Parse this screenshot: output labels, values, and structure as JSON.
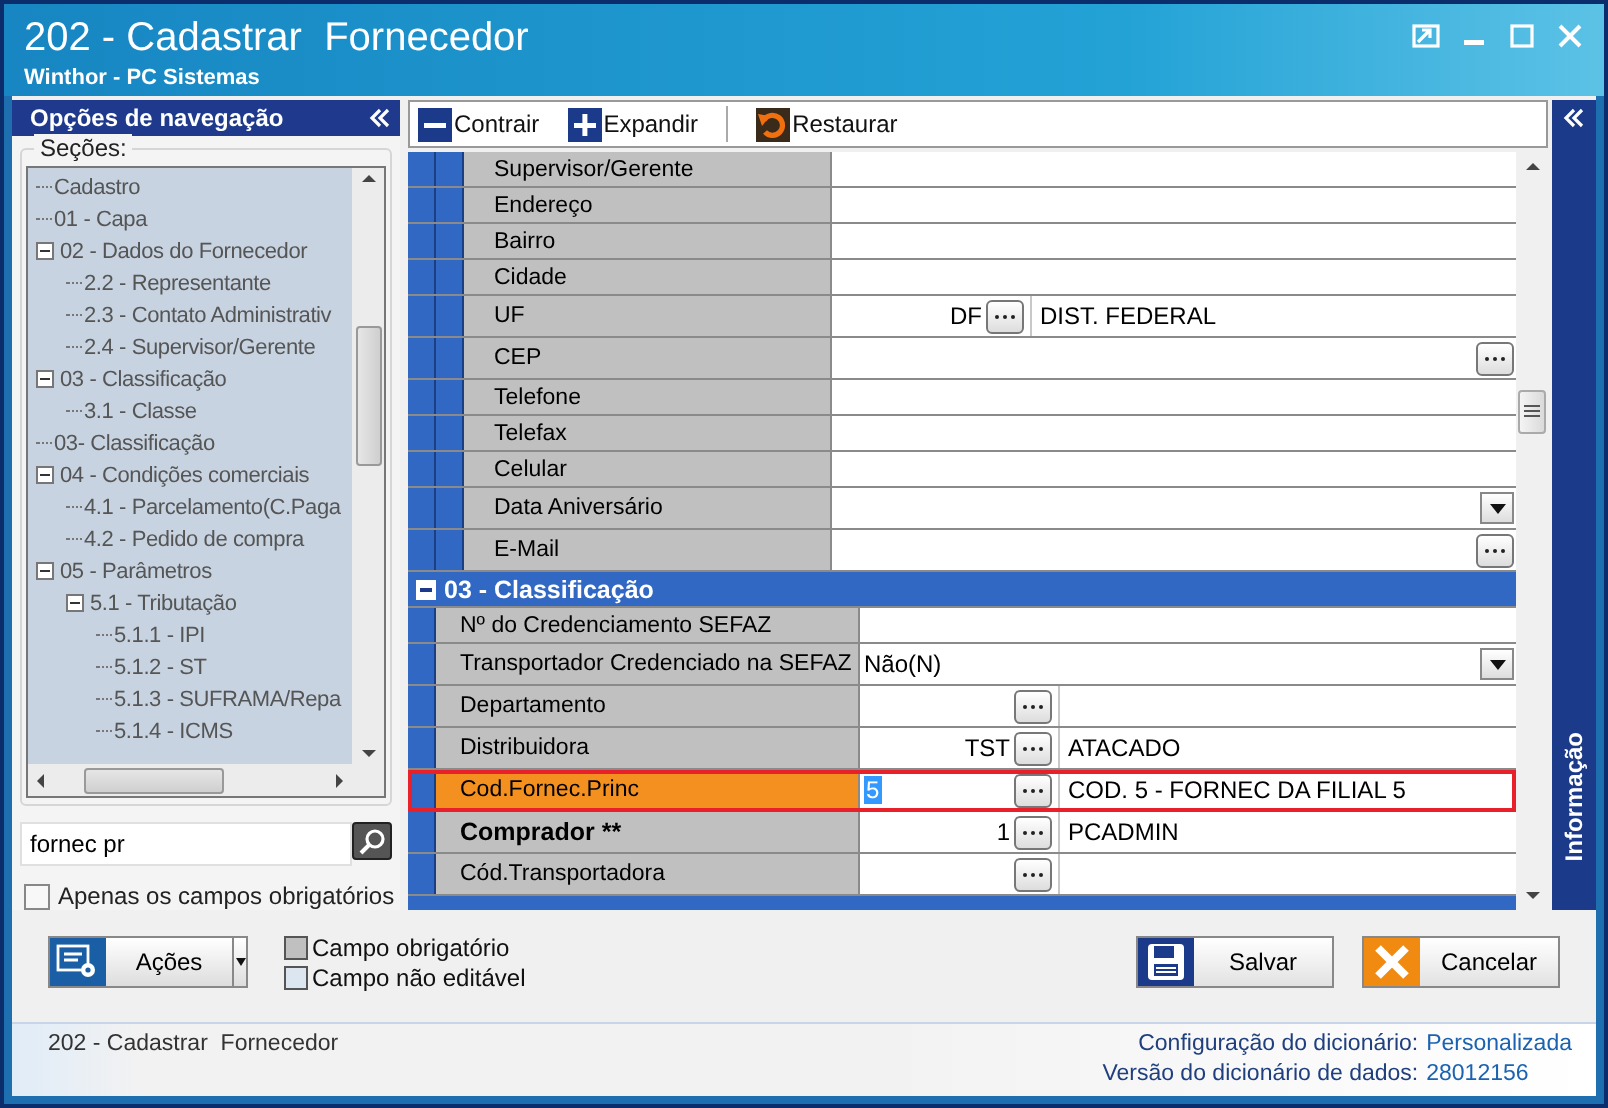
{
  "window": {
    "title": "202 - Cadastrar  Fornecedor",
    "subtitle": "Winthor - PC Sistemas"
  },
  "navigation": {
    "title": "Opções de navegação",
    "sections_label": "Seções:",
    "tree": [
      {
        "label": "Cadastro"
      },
      {
        "label": "01 - Capa"
      },
      {
        "label": "02 - Dados do Fornecedor",
        "expanded": true,
        "children": [
          {
            "label": "2.2 - Representante"
          },
          {
            "label": "2.3 - Contato Administrativ"
          },
          {
            "label": "2.4 - Supervisor/Gerente"
          }
        ]
      },
      {
        "label": "03 - Classificação",
        "expanded": true,
        "children": [
          {
            "label": "3.1 - Classe"
          }
        ]
      },
      {
        "label": "03- Classificação"
      },
      {
        "label": "04 - Condições comerciais",
        "expanded": true,
        "children": [
          {
            "label": "4.1 - Parcelamento(C.Paga"
          },
          {
            "label": "4.2 - Pedido de compra"
          }
        ]
      },
      {
        "label": "05 - Parâmetros",
        "expanded": true,
        "children": [
          {
            "label": "5.1 - Tributação",
            "expanded": true,
            "children": [
              {
                "label": "5.1.1 - IPI"
              },
              {
                "label": "5.1.2 - ST"
              },
              {
                "label": "5.1.3 - SUFRAMA/Repa"
              },
              {
                "label": "5.1.4 - ICMS"
              }
            ]
          }
        ]
      }
    ],
    "search": {
      "value": "fornec pr"
    },
    "required_only": {
      "label": "Apenas os campos obrigatórios",
      "checked": false
    }
  },
  "toolbar": [
    {
      "label": "Contrair",
      "kind": "collapse"
    },
    {
      "label": "Expandir",
      "kind": "expand"
    },
    {
      "label": "Restaurar",
      "kind": "restore"
    }
  ],
  "grid": {
    "sections": [
      {
        "subsections": [
          {
            "rows": [
              {
                "label": "Supervisor/Gerente",
                "kind": "text",
                "selected": false,
                "bold": false
              },
              {
                "label": "Endereço",
                "kind": "text",
                "selected": false,
                "bold": false
              },
              {
                "label": "Bairro",
                "kind": "text",
                "selected": false,
                "bold": false
              },
              {
                "label": "Cidade",
                "kind": "text",
                "selected": false,
                "bold": false
              },
              {
                "label": "UF",
                "kind": "lookup",
                "code": "DF",
                "description": "DIST. FEDERAL",
                "selected": false,
                "bold": false
              },
              {
                "label": "CEP",
                "kind": "ellipsis",
                "selected": false,
                "bold": false
              },
              {
                "label": "Telefone",
                "kind": "text",
                "selected": false,
                "bold": false
              },
              {
                "label": "Telefax",
                "kind": "text",
                "selected": false,
                "bold": false
              },
              {
                "label": "Celular",
                "kind": "text",
                "selected": false,
                "bold": false
              },
              {
                "label": "Data Aniversário",
                "kind": "dropdown",
                "selected": false,
                "bold": false
              },
              {
                "label": "E-Mail",
                "kind": "ellipsis",
                "selected": false,
                "bold": false
              }
            ]
          }
        ]
      },
      {
        "title": "03 - Classificação",
        "expanded": true,
        "rows": [
          {
            "label": "Nº do Credenciamento SEFAZ",
            "kind": "text",
            "selected": false,
            "bold": false
          },
          {
            "label": "Transportador Credenciado na SEFAZ",
            "kind": "dropdown",
            "value": "Não(N)",
            "selected": false,
            "bold": false
          },
          {
            "label": "Departamento",
            "kind": "lookup",
            "selected": false,
            "bold": false
          },
          {
            "label": "Distribuidora",
            "kind": "lookup",
            "code": "TST",
            "description": "ATACADO",
            "selected": false,
            "bold": false
          },
          {
            "label": "Cod.Fornec.Princ",
            "kind": "lookup",
            "code": "5",
            "description": "COD. 5 - FORNEC DA FILIAL 5",
            "selected": true,
            "bold": false
          },
          {
            "label": "Comprador **",
            "kind": "lookup",
            "code": "1",
            "description": "PCADMIN",
            "selected": false,
            "bold": true
          },
          {
            "label": "Cód.Transportadora",
            "kind": "lookup",
            "selected": false,
            "bold": false
          }
        ]
      }
    ]
  },
  "info_panel": {
    "title": "Informação"
  },
  "actions": {
    "label": "Ações"
  },
  "legend": [
    {
      "label": "Campo obrigatório",
      "color": "#c0c0c0"
    },
    {
      "label": "Campo não editável",
      "color": "#dce6f0"
    }
  ],
  "buttons": [
    {
      "label": "Salvar",
      "kind": "save"
    },
    {
      "label": "Cancelar",
      "kind": "cancel"
    }
  ],
  "status_bar": {
    "text": "202 - Cadastrar  Fornecedor",
    "fields": [
      {
        "label": "Configuração do dicionário:",
        "value": "Personalizada"
      },
      {
        "label": "Versão do dicionário de dados:",
        "value": "28012156"
      }
    ]
  }
}
